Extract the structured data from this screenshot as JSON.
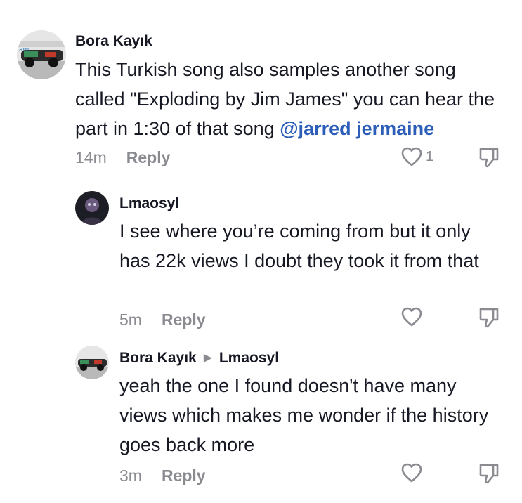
{
  "comments": [
    {
      "author": "Bora Kayık",
      "text": "This Turkish song also samples another song called \"Exploding by Jim James\" you can hear the part in 1:30 of that song",
      "mention": "@jarred jermaine",
      "time": "14m",
      "reply_label": "Reply",
      "likes": "1",
      "avatar_icon": "profile-photo-race-car"
    },
    {
      "author": "Lmaosyl",
      "text": "I see where you’re coming from but it only has 22k views I doubt they took it from that",
      "time": "5m",
      "reply_label": "Reply",
      "avatar_icon": "profile-photo-dark-figure"
    },
    {
      "author": "Bora Kayık",
      "reply_to": "Lmaosyl",
      "text": "yeah the one I found doesn't have many views which makes me wonder if the history goes back more",
      "time": "3m",
      "reply_label": "Reply",
      "avatar_icon": "profile-photo-race-car"
    }
  ],
  "colors": {
    "text": "#161823",
    "muted": "#8a8b91",
    "mention": "#2b5db9"
  }
}
